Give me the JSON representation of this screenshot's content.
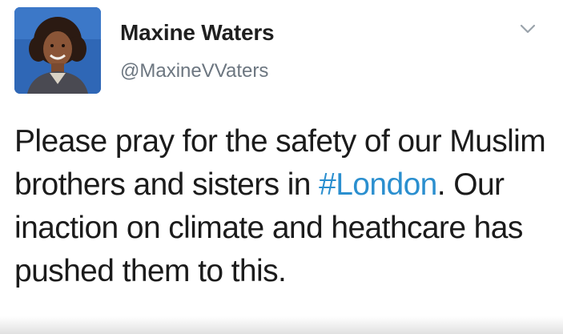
{
  "tweet": {
    "author": {
      "display_name": "Maxine Waters",
      "handle": "@MaxineVVaters",
      "avatar_icon": "profile-photo"
    },
    "menu_icon": "chevron-down-icon",
    "text_before_hashtag": "Please pray for the safety of our Muslim brothers and sisters in ",
    "hashtag": "#London",
    "text_after_hashtag": ". Our inaction on climate and heathcare has pushed them to this."
  },
  "colors": {
    "hashtag": "#2b8fcf",
    "handle": "#6c7680",
    "text": "#1b1b1b",
    "avatar_background": "#2f67b6"
  }
}
